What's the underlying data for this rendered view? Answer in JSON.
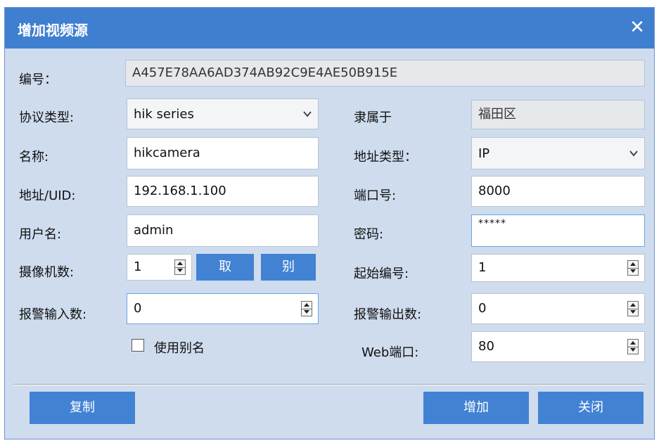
{
  "title": "增加视频源",
  "close_glyph": "✕",
  "labels": {
    "id": "编号：",
    "protocol": "协议类型:",
    "belongs_to": "隶属于",
    "name": "名称:",
    "address_type": "地址类型：",
    "address": "地址/UID:",
    "port": "端口号:",
    "username": "用户名:",
    "password": "密码:",
    "camera_count": "摄像机数:",
    "start_number": "起始编号:",
    "alarm_in": "报警输入数:",
    "alarm_out": "报警输出数:",
    "use_alias": "使用别名",
    "web_port": "Web端口:"
  },
  "values": {
    "id": "A457E78AA6AD374AB92C9E4AE50B915E",
    "protocol": "hik series",
    "belongs_to": "福田区",
    "name": "hikcamera",
    "address_type": "IP",
    "address": "192.168.1.100",
    "port": "8000",
    "username": "admin",
    "password": "*****",
    "camera_count": "1",
    "start_number": "1",
    "alarm_in": "0",
    "alarm_out": "0",
    "web_port": "80",
    "use_alias_checked": false
  },
  "buttons": {
    "take": "取",
    "alias": "别",
    "copy": "复制",
    "add": "增加",
    "close": "关闭"
  },
  "colors": {
    "titlebar": "#3f7fd0",
    "dialog_bg": "#cfdcee",
    "button": "#4282d3"
  }
}
